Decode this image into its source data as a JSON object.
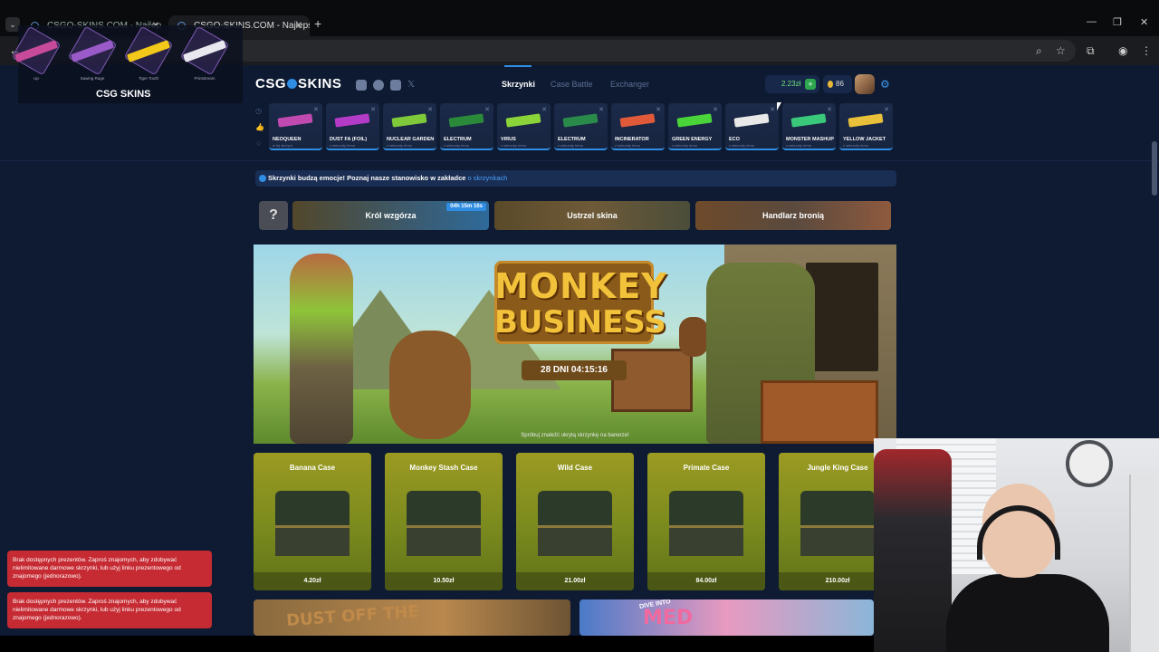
{
  "browser": {
    "tabs": [
      {
        "title": "CSGO-SKINS.COM - Najlep"
      },
      {
        "title": "CSGO-SKINS.COM - Najlepsze"
      }
    ],
    "new_tab": "+",
    "win": {
      "min": "—",
      "max": "❐",
      "close": "✕"
    }
  },
  "site": {
    "logo_left": "CSG",
    "logo_right": "SKINS",
    "nav": {
      "cases": "Skrzynki",
      "battle": "Case Battle",
      "exchanger": "Exchanger"
    },
    "balance": "2.23zł",
    "coins": "86",
    "drops": [
      {
        "name": "NEOQUEEN",
        "sub": "w tej skrzyni",
        "color": "#c04ab0"
      },
      {
        "name": "DUST FA (FOIL)",
        "sub": "z sekundy temu",
        "color": "#b43ac8"
      },
      {
        "name": "NUCLEAR GARDEN",
        "sub": "z sekundy temu",
        "color": "#7ec83a"
      },
      {
        "name": "ELECTRUM",
        "sub": "z sekundy temu",
        "color": "#2a8a3a"
      },
      {
        "name": "VIRUS",
        "sub": "z sekundy temu",
        "color": "#8ad43a"
      },
      {
        "name": "ELECTRUM",
        "sub": "z sekundy temu",
        "color": "#2a8a4a"
      },
      {
        "name": "INCINERATOR",
        "sub": "z sekundy temu",
        "color": "#e05a3a"
      },
      {
        "name": "GREEN ENERGY",
        "sub": "z sekundy temu",
        "color": "#4ad43a"
      },
      {
        "name": "ECO",
        "sub": "z sekundy temu",
        "color": "#e8e8e8"
      },
      {
        "name": "MONSTER MASHUP",
        "sub": "z sekundy temu",
        "color": "#3ac87a"
      },
      {
        "name": "YELLOW JACKET",
        "sub": "z sekundy temu",
        "color": "#e8c03a"
      }
    ],
    "info_text": "Skrzynki budzą emocje! Poznaj nasze stanowisko w zakładce",
    "info_link": "o skrzynkach",
    "modes": {
      "q": "?",
      "king": "Król wzgórza",
      "king_timer": "04h 15m 16s",
      "shoot": "Ustrzel skina",
      "dealer": "Handlarz bronią"
    },
    "banner": {
      "title1": "MONKEY",
      "title2": "BUSINESS",
      "countdown": "28 DNI 04:15:16",
      "hint": "Spróbuj znaleźć ukrytą skrzynkę na banerze!"
    },
    "cases": [
      {
        "name": "Banana Case",
        "price": "4.20zł"
      },
      {
        "name": "Monkey Stash Case",
        "price": "10.50zł"
      },
      {
        "name": "Wild Case",
        "price": "21.00zł"
      },
      {
        "name": "Primate Case",
        "price": "84.00zł"
      },
      {
        "name": "Jungle King Case",
        "price": "210.00zł"
      }
    ],
    "promo1": "DUST OFF THE",
    "promo2": "MED",
    "promo2_tag": "DIVE INTO",
    "toasts": [
      "Brak dostępnych prezentów. Zaproś znajomych, aby zdobywać nielimitowane darmowe skrzynki, lub użyj linku prezentowego od znajomego (jednorazowo).",
      "Brak dostępnych prezentów. Zaproś znajomych, aby zdobywać nielimitowane darmowe skrzynki, lub użyj linku prezentowego od znajomego (jednorazowo)."
    ]
  },
  "overlay": {
    "items": [
      {
        "label": "Up",
        "color": "#c84a9a"
      },
      {
        "label": "Sawing Rage",
        "color": "#9a5ac8"
      },
      {
        "label": "Tiger Tooth",
        "color": "#f2c81a"
      },
      {
        "label": "Printstream",
        "color": "#e8e8ee"
      }
    ],
    "logo": "CSG SKINS"
  }
}
